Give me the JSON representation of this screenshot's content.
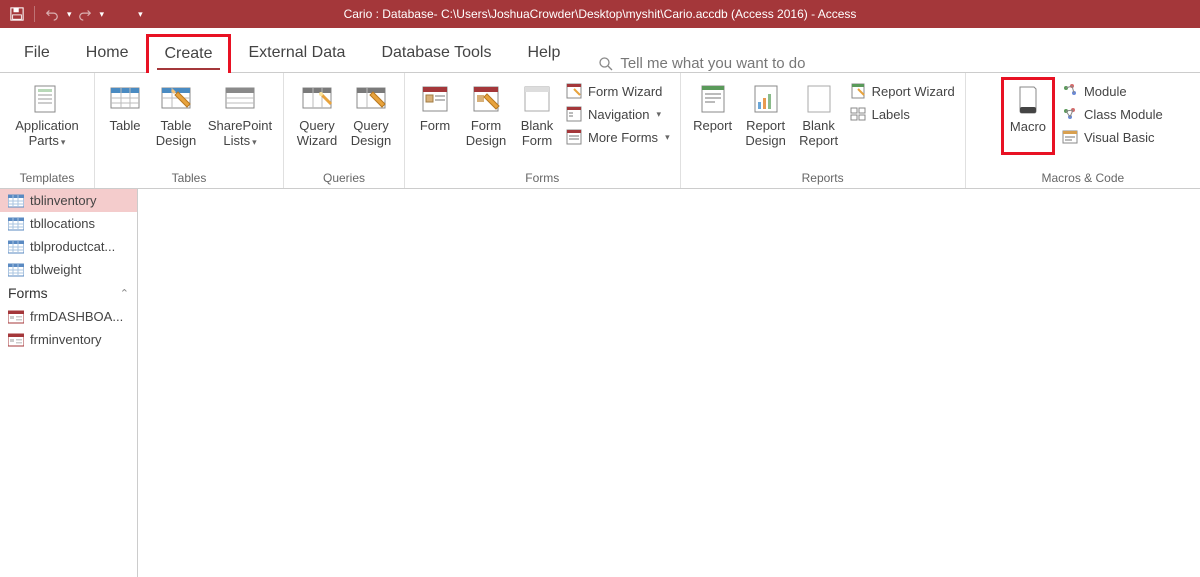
{
  "titlebar": "Cario : Database- C:\\Users\\JoshuaCrowder\\Desktop\\myshit\\Cario.accdb (Access 2016)  -  Access",
  "tabs": {
    "file": "File",
    "home": "Home",
    "create": "Create",
    "external": "External Data",
    "dbtools": "Database Tools",
    "help": "Help"
  },
  "tellme": "Tell me what you want to do",
  "groups": {
    "templates": {
      "label": "Templates",
      "appparts": "Application Parts"
    },
    "tables": {
      "label": "Tables",
      "table": "Table",
      "tdesign": "Table Design",
      "splists": "SharePoint Lists"
    },
    "queries": {
      "label": "Queries",
      "qwizard": "Query Wizard",
      "qdesign": "Query Design"
    },
    "forms": {
      "label": "Forms",
      "form": "Form",
      "fdesign": "Form Design",
      "blank": "Blank Form",
      "fwizard": "Form Wizard",
      "nav": "Navigation",
      "more": "More Forms"
    },
    "reports": {
      "label": "Reports",
      "report": "Report",
      "rdesign": "Report Design",
      "rblank": "Blank Report",
      "rwizard": "Report Wizard",
      "labels": "Labels"
    },
    "macros": {
      "label": "Macros & Code",
      "macro": "Macro",
      "module": "Module",
      "classmod": "Class Module",
      "vb": "Visual Basic"
    }
  },
  "nav": {
    "tables": [
      "tblinventory",
      "tbllocations",
      "tblproductcat...",
      "tblweight"
    ],
    "forms_header": "Forms",
    "forms": [
      "frmDASHBOA...",
      "frminventory"
    ]
  }
}
